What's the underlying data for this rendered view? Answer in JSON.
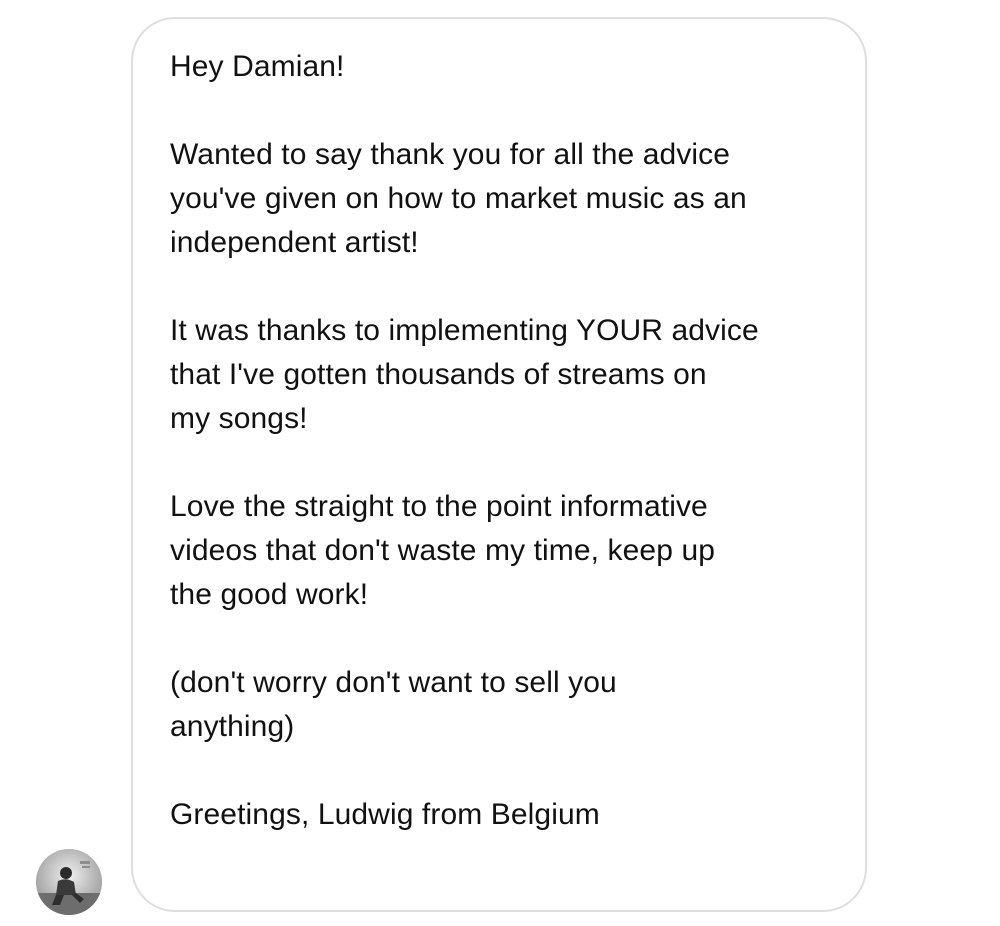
{
  "conversation": {
    "message": {
      "text": "Hey Damian!\n\nWanted to say thank you for all the advice\nyou've given on how to market music as an\nindependent artist!\n\nIt was thanks to implementing YOUR advice\nthat I've gotten thousands of streams on\nmy songs!\n\nLove the straight to the point informative\nvideos that don't waste my time, keep up\nthe good work!\n\n(don't worry don't want to sell you\nanything)\n\nGreetings, Ludwig from Belgium"
    },
    "sender": {
      "avatar_icon": "profile-photo"
    }
  },
  "colors": {
    "bubble_border": "#dedede",
    "text": "#111111",
    "background": "#ffffff"
  }
}
